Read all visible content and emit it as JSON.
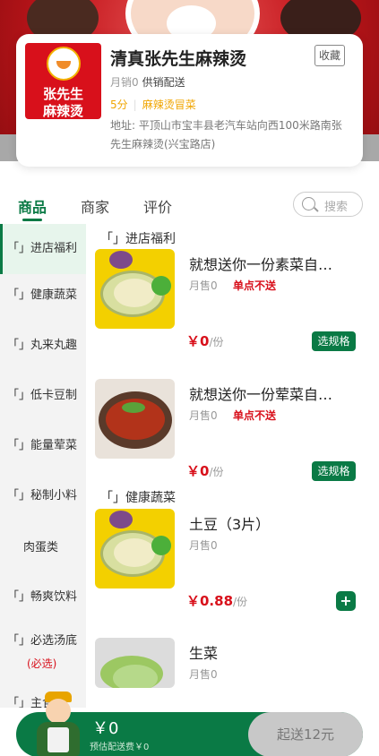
{
  "shop": {
    "name": "清真张先生麻辣烫",
    "logo_line1": "张先生",
    "logo_line2": "麻辣烫",
    "favorite_label": "收藏",
    "monthly_sales": "月销0",
    "delivery": "供销配送",
    "rating": "5分",
    "category": "麻辣烫冒菜",
    "address": "地址: 平顶山市宝丰县老汽车站向西100米路南张先生麻辣烫(兴宝路店)"
  },
  "tabs": [
    {
      "label": "商品",
      "active": true
    },
    {
      "label": "商家",
      "active": false
    },
    {
      "label": "评价",
      "active": false
    }
  ],
  "search": {
    "placeholder": "搜索"
  },
  "sidebar": {
    "items": [
      {
        "label": "「」进店福利",
        "active": true
      },
      {
        "label": "「」健康蔬菜"
      },
      {
        "label": "「」丸来丸趣"
      },
      {
        "label": "「」低卡豆制"
      },
      {
        "label": "「」能量荤菜"
      },
      {
        "label": "「」秘制小料"
      },
      {
        "label": "肉蛋类"
      },
      {
        "label": "「」畅爽饮料"
      },
      {
        "label": "「」必选汤底",
        "sub": "(必选)"
      },
      {
        "label": "「」主食面"
      }
    ]
  },
  "sections": [
    {
      "title": "「」进店福利"
    },
    {
      "title": "「」健康蔬菜"
    }
  ],
  "dishes": [
    {
      "name": "就想送你一份素菜自…",
      "sales": "月售0",
      "tag": "单点不送",
      "price": "￥0",
      "unit": "/份",
      "action": "选规格"
    },
    {
      "name": "就想送你一份荤菜自…",
      "sales": "月售0",
      "tag": "单点不送",
      "price": "￥0",
      "unit": "/份",
      "action": "选规格"
    },
    {
      "name": "土豆（3片）",
      "sales": "月售0",
      "price": "￥0.88",
      "unit": "/份",
      "action": "+"
    },
    {
      "name": "生菜",
      "sales": "月售0"
    }
  ],
  "cart": {
    "total": "￥0",
    "fee": "预估配送费￥0",
    "submit": "起送12元"
  },
  "colors": {
    "brand_green": "#0a7a45",
    "price_red": "#d8101b",
    "rating_orange": "#f0a500"
  }
}
